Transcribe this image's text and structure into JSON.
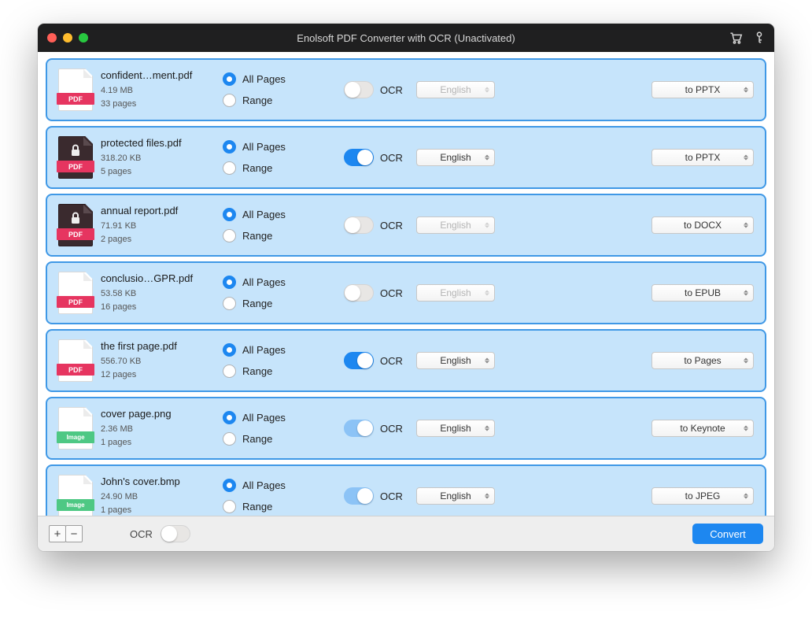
{
  "window": {
    "title": "Enolsoft PDF Converter with OCR (Unactivated)"
  },
  "rows": [
    {
      "icon_type": "pdf",
      "locked": false,
      "name": "confident…ment.pdf",
      "size": "4.19 MB",
      "pages": "33 pages",
      "all_pages_label": "All Pages",
      "range_label": "Range",
      "page_opt": "all",
      "ocr_state": "off",
      "ocr_label": "OCR",
      "language": "English",
      "lang_disabled": true,
      "format": "to PPTX"
    },
    {
      "icon_type": "pdf-locked",
      "locked": true,
      "name": "protected files.pdf",
      "size": "318.20 KB",
      "pages": "5 pages",
      "all_pages_label": "All Pages",
      "range_label": "Range",
      "page_opt": "all",
      "ocr_state": "on",
      "ocr_label": "OCR",
      "language": "English",
      "lang_disabled": false,
      "format": "to PPTX"
    },
    {
      "icon_type": "pdf-locked",
      "locked": true,
      "name": "annual report.pdf",
      "size": "71.91 KB",
      "pages": "2 pages",
      "all_pages_label": "All Pages",
      "range_label": "Range",
      "page_opt": "all",
      "ocr_state": "off",
      "ocr_label": "OCR",
      "language": "English",
      "lang_disabled": true,
      "format": "to DOCX"
    },
    {
      "icon_type": "pdf",
      "locked": false,
      "name": "conclusio…GPR.pdf",
      "size": "53.58 KB",
      "pages": "16 pages",
      "all_pages_label": "All Pages",
      "range_label": "Range",
      "page_opt": "all",
      "ocr_state": "off",
      "ocr_label": "OCR",
      "language": "English",
      "lang_disabled": true,
      "format": "to EPUB"
    },
    {
      "icon_type": "pdf",
      "locked": false,
      "name": "the first page.pdf",
      "size": "556.70 KB",
      "pages": "12 pages",
      "all_pages_label": "All Pages",
      "range_label": "Range",
      "page_opt": "all",
      "ocr_state": "on",
      "ocr_label": "OCR",
      "language": "English",
      "lang_disabled": false,
      "format": "to Pages"
    },
    {
      "icon_type": "image",
      "locked": false,
      "name": "cover page.png",
      "size": "2.36 MB",
      "pages": "1 pages",
      "all_pages_label": "All Pages",
      "range_label": "Range",
      "page_opt": "all",
      "ocr_state": "semi",
      "ocr_label": "OCR",
      "language": "English",
      "lang_disabled": false,
      "format": "to Keynote"
    },
    {
      "icon_type": "image",
      "locked": false,
      "name": "John's cover.bmp",
      "size": "24.90 MB",
      "pages": "1 pages",
      "all_pages_label": "All Pages",
      "range_label": "Range",
      "page_opt": "all",
      "ocr_state": "semi",
      "ocr_label": "OCR",
      "language": "English",
      "lang_disabled": false,
      "format": "to JPEG"
    }
  ],
  "icon_labels": {
    "pdf": "PDF",
    "image": "Image"
  },
  "footer": {
    "ocr_label": "OCR",
    "ocr_state": "off",
    "convert_label": "Convert",
    "add_label": "+",
    "remove_label": "−"
  }
}
